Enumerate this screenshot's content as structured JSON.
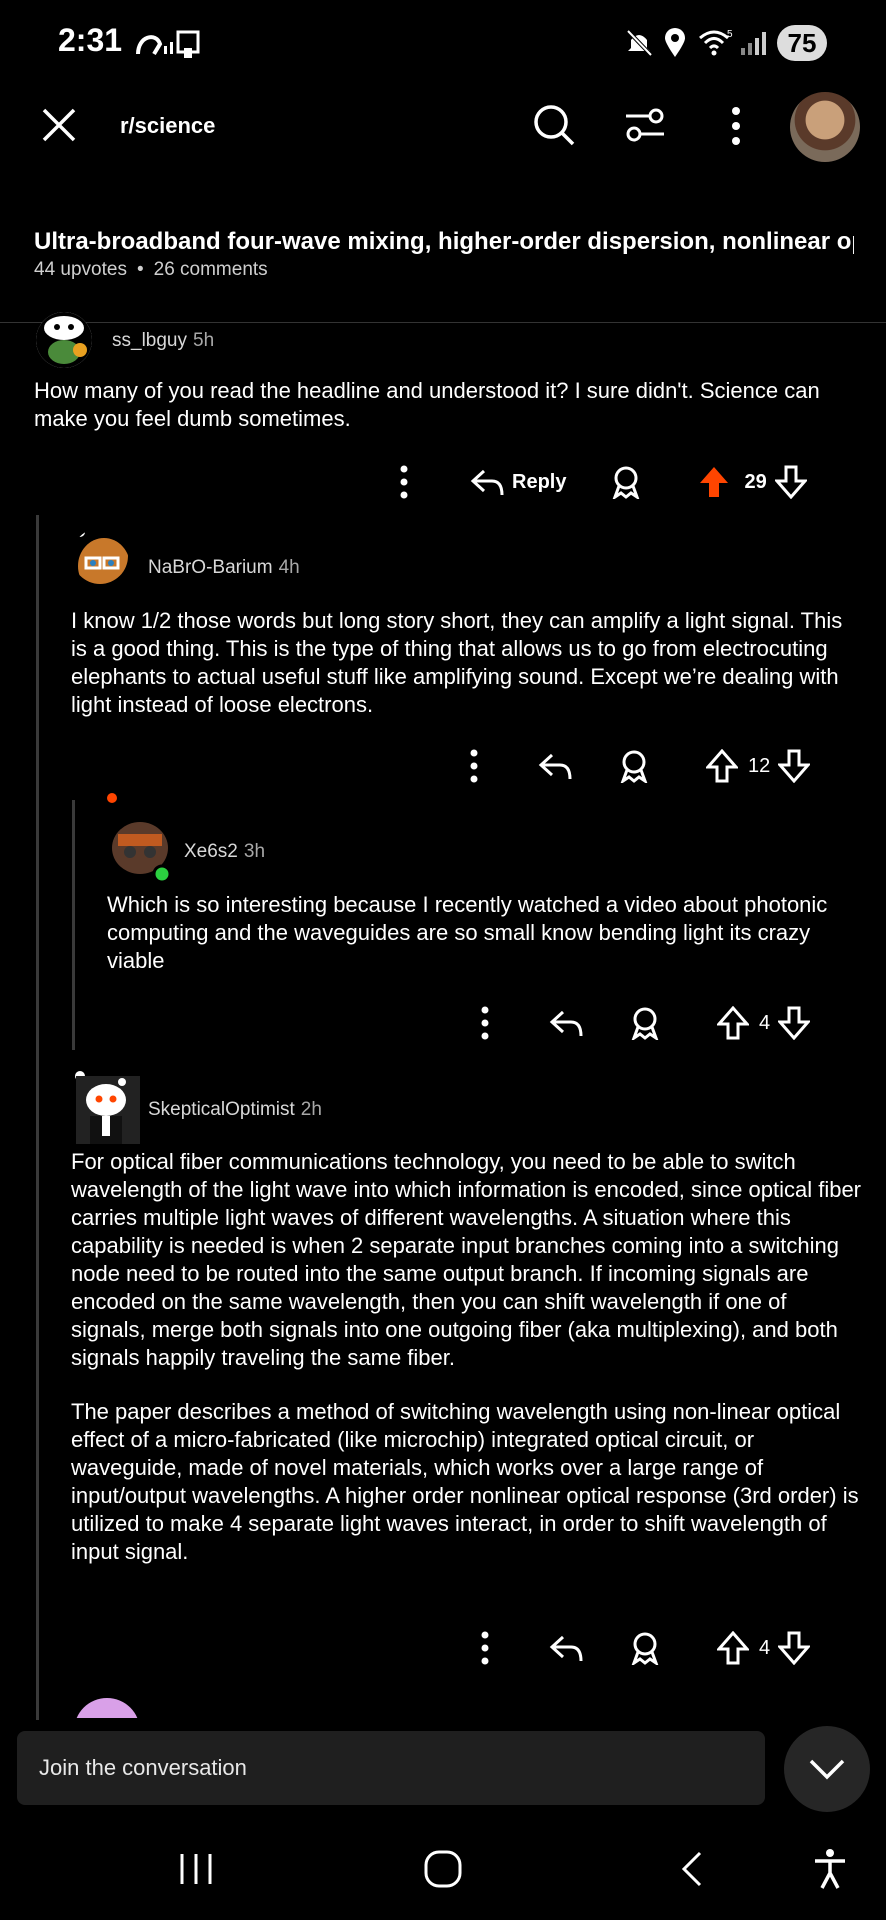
{
  "status_bar": {
    "time": "2:31",
    "battery": "75"
  },
  "header": {
    "subreddit": "r/science"
  },
  "post": {
    "title": "Ultra-broadband four-wave mixing, higher-order dispersion, nonlinear opti...",
    "upvotes": "44 upvotes",
    "comments": "26 comments"
  },
  "comments": [
    {
      "user": "ss_lbguy",
      "time": "5h",
      "paragraphs": [
        "How many of you read the headline and understood it? I sure didn't. Science can make you feel dumb sometimes."
      ],
      "votes": "29",
      "reply_label": "Reply"
    },
    {
      "user": "NaBrO-Barium",
      "time": "4h",
      "paragraphs": [
        "I know 1/2 those words but long story short, they can amplify a light signal. This is a good thing. This is the type of thing that allows us to go from electrocuting elephants to actual useful stuff like amplifying sound. Except we’re dealing with light instead of loose electrons."
      ],
      "votes": "12"
    },
    {
      "user": "Xe6s2",
      "time": "3h",
      "paragraphs": [
        "Which is so interesting because I recently watched a video about photonic computing and the waveguides are so small know bending light its crazy viable"
      ],
      "votes": "4"
    },
    {
      "user": "SkepticalOptimist",
      "time": "2h",
      "paragraphs": [
        "For optical fiber communications technology, you need to be able to switch wavelength of the light wave into which information is encoded, since optical fiber carries multiple light waves of different wavelengths. A situation where this capability is needed is when 2 separate input branches coming into a switching node need to be routed into the same output branch. If incoming signals are encoded on the same wavelength, then you can shift wavelength if one of signals, merge both signals into one outgoing fiber (aka multiplexing), and both signals happily traveling the same fiber.",
        "The paper describes a method of switching wavelength using non-linear optical effect of a micro-fabricated (like microchip) integrated optical circuit, or waveguide, made of novel materials, which works over a large range of input/output wavelengths. A higher order nonlinear optical response (3rd order) is utilized to make 4 separate light waves interact, in order to shift wavelength of input signal."
      ],
      "votes": "4"
    }
  ],
  "composer": {
    "placeholder": "Join the conversation"
  },
  "colors": {
    "upvote_active": "#ff4500",
    "background": "#000000",
    "thread_line": "#3a3a3a"
  }
}
